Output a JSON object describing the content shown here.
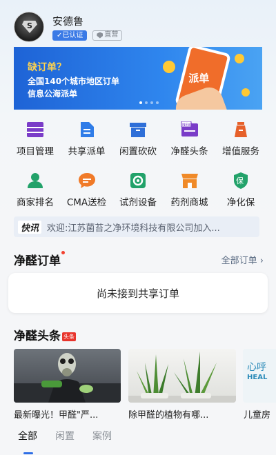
{
  "user": {
    "name": "安德鲁",
    "verified_label": "✓已认证",
    "direct_label": "直营",
    "avatar_letter": "S"
  },
  "banner": {
    "line1_prefix": "缺订单？",
    "line2": "全国140个城市地区订单",
    "line3": "信息公海派单",
    "phone_text": "派单"
  },
  "grid": [
    {
      "label": "项目管理",
      "icon": "project-icon",
      "color": "#7a3cc8"
    },
    {
      "label": "共享派单",
      "icon": "document-icon",
      "color": "#2f7ce8"
    },
    {
      "label": "闲置砍砍",
      "icon": "box-icon",
      "color": "#2f6fd8"
    },
    {
      "label": "净醛头条",
      "icon": "news-icon",
      "color": "#7a3cc8"
    },
    {
      "label": "增值服务",
      "icon": "jar-icon",
      "color": "#e6602a"
    },
    {
      "label": "商家排名",
      "icon": "user-ranking-icon",
      "color": "#22a26a"
    },
    {
      "label": "CMA送检",
      "icon": "chat-icon",
      "color": "#f07a28"
    },
    {
      "label": "试剂设备",
      "icon": "gear-icon",
      "color": "#22a26a"
    },
    {
      "label": "药剂商城",
      "icon": "shop-icon",
      "color": "#f08a28"
    },
    {
      "label": "净化保",
      "icon": "shield-icon",
      "color": "#22a26a",
      "glyph": "保"
    }
  ],
  "ticker": {
    "logo": "快讯",
    "text": "欢迎:江苏菌苔之净环境科技有限公司加入..."
  },
  "orders": {
    "title": "净醛订单",
    "more": "全部订单 ›",
    "empty": "尚未接到共享订单"
  },
  "headlines": {
    "title": "净醛头条",
    "badge": "头条",
    "items": [
      {
        "caption": "最新曝光！甲醛\"严..."
      },
      {
        "caption": "除甲醛的植物有哪..."
      },
      {
        "caption": "儿童房",
        "image_text": "心呼",
        "image_sub": "HEAL"
      }
    ]
  },
  "tabs": [
    "全部",
    "闲置",
    "案例"
  ]
}
